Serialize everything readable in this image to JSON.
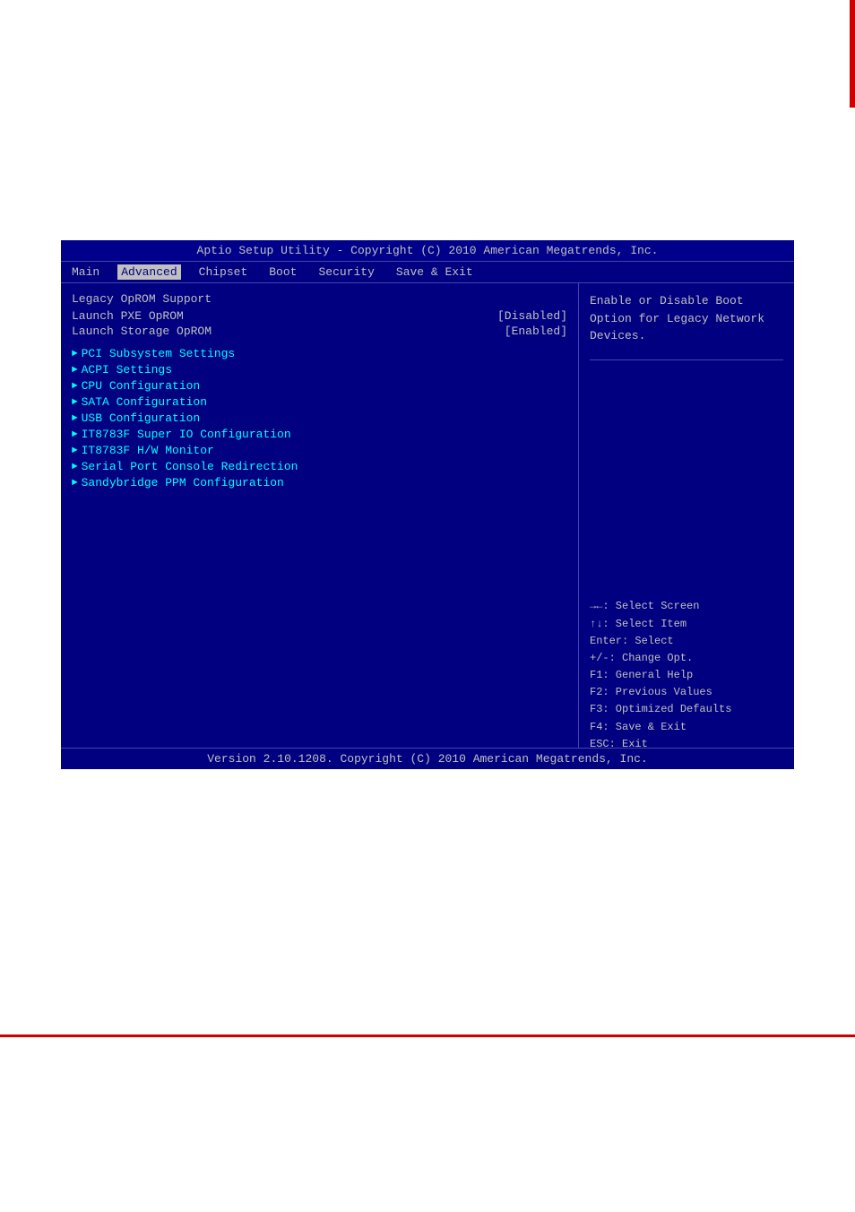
{
  "decorative": {
    "red_bar_top": true,
    "red_bar_bottom": true
  },
  "bios": {
    "title": "Aptio Setup Utility - Copyright (C) 2010 American Megatrends, Inc.",
    "footer": "Version 2.10.1208. Copyright (C) 2010 American Megatrends, Inc.",
    "menu": {
      "items": [
        {
          "label": "Main",
          "active": false
        },
        {
          "label": "Advanced",
          "active": true
        },
        {
          "label": "Chipset",
          "active": false
        },
        {
          "label": "Boot",
          "active": false
        },
        {
          "label": "Security",
          "active": false
        },
        {
          "label": "Save & Exit",
          "active": false
        }
      ]
    },
    "left": {
      "legacy_section_label": "Legacy OpROM Support",
      "settings": [
        {
          "label": "Launch PXE OpROM",
          "value": "[Disabled]"
        },
        {
          "label": "Launch Storage OpROM",
          "value": "[Enabled]"
        }
      ],
      "nav_items": [
        "PCI Subsystem Settings",
        "ACPI Settings",
        "CPU Configuration",
        "SATA Configuration",
        "USB Configuration",
        "IT8783F Super IO Configuration",
        "IT8783F H/W Monitor",
        "Serial Port Console Redirection",
        "Sandybridge PPM Configuration"
      ]
    },
    "right": {
      "help_text": "Enable or Disable Boot Option for Legacy Network Devices.",
      "key_help": [
        "→←: Select Screen",
        "↑↓: Select Item",
        "Enter: Select",
        "+/-: Change Opt.",
        "F1: General Help",
        "F2: Previous Values",
        "F3: Optimized Defaults",
        "F4: Save & Exit",
        "ESC: Exit"
      ]
    }
  }
}
